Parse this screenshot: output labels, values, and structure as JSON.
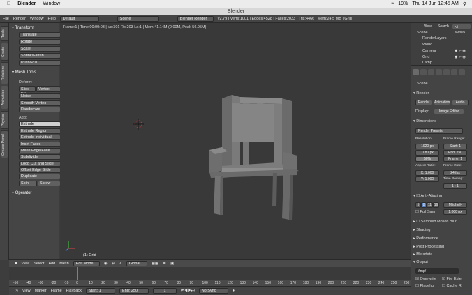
{
  "menubar": {
    "app": "Blender",
    "window": "Window",
    "date_time": "Thu 14 Jun 12:45 AM",
    "battery": "19%"
  },
  "window_title": "Blender",
  "infobar": {
    "menus": [
      "File",
      "Render",
      "Window",
      "Help"
    ],
    "layout": "Default",
    "scene": "Scene",
    "engine": "Blender Render",
    "stats": "v2.79 | Verts:1001 | Edges:4528 | Faces:2033 | Tris:4466 | Mem:24.5 MB | Grid"
  },
  "left_tabs": [
    "Tools",
    "Create",
    "Relations",
    "Animation",
    "Physics",
    "Grease Pencil"
  ],
  "toolshelf": {
    "transform_header": "Transform",
    "transform_buttons": [
      "Translate",
      "Rotate",
      "Scale",
      "Shrink/Fatten",
      "Push/Pull"
    ],
    "mesh_tools_header": "Mesh Tools",
    "deform_label": "Deform:",
    "deform_buttons": [
      "Slide Ed",
      "Vertex",
      "Noise",
      "Smooth Vertex",
      "Randomize"
    ],
    "add_label": "Add:",
    "add_buttons": [
      "Extrude",
      "Extrude Region",
      "Extrude Individual",
      "Inset Faces",
      "Make Edge/Face",
      "Subdivide",
      "Loop Cut and Slide",
      "Offset Edge Slide",
      "Duplicate",
      "Spin",
      "Screw"
    ],
    "operator_header": "Operator"
  },
  "viewport": {
    "info": "Frame:1 | Time:00:00:03 | Ve:301 Ro:203 La:1 | Mem:41.14M (0.00M, Peak 56.95M)",
    "object_label": "(1) Grid"
  },
  "outliner": {
    "buttons": [
      "View",
      "Search",
      "All Scenes"
    ],
    "items": [
      "Scene",
      "RenderLayers",
      "World",
      "Camera",
      "Grid",
      "Lamp"
    ]
  },
  "properties": {
    "scene_label": "Scene",
    "render_header": "Render",
    "render_buttons": [
      "Render",
      "Animation",
      "Audio"
    ],
    "display_label": "Display:",
    "display_value": "Image Editor",
    "dimensions_header": "Dimensions",
    "render_presets": "Render Presets",
    "resolution_label": "Resolution:",
    "res_x": "1920 px",
    "res_y": "1080 px",
    "res_pct": "50%",
    "frame_range_label": "Frame Range:",
    "start": "Start: 1",
    "end": "End: 250",
    "step": "Frame: 1",
    "aspect_label": "Aspect Ratio:",
    "aspect_x": "X: 1.000",
    "aspect_y": "Y: 1.000",
    "frame_rate_label": "Frame Rate:",
    "fps": "24 fps",
    "time_remap_label": "Time Remap:",
    "remap": "1 : 1",
    "aa_header": "Anti-Aliasing",
    "aa_samples": [
      "5",
      "8",
      "11",
      "16"
    ],
    "aa_filter": "Mitchell-",
    "full_sample": "Full Sam",
    "filter_size": "1.000 px",
    "collapsed_sections": [
      "Sampled Motion Blur",
      "Shading",
      "Performance",
      "Post Processing",
      "Metadata"
    ],
    "output_header": "Output",
    "output_path": "/tmp/",
    "overwrite": "Overwrite",
    "file_ext": "File Exte",
    "placeholders": "Placeho",
    "cache_result": "Cache R"
  },
  "view3d_header": {
    "menus": [
      "View",
      "Select",
      "Add",
      "Mesh"
    ],
    "mode": "Edit Mode",
    "orientation": "Global"
  },
  "timeline": {
    "ticks": [
      "-50",
      "-40",
      "-30",
      "-20",
      "-10",
      "0",
      "10",
      "20",
      "30",
      "40",
      "50",
      "60",
      "70",
      "80",
      "90",
      "100",
      "110",
      "120",
      "130",
      "140",
      "150",
      "160",
      "170",
      "180",
      "190",
      "200",
      "210",
      "220",
      "230",
      "240",
      "250",
      "260"
    ],
    "menus": [
      "View",
      "Marker",
      "Frame",
      "Playback"
    ],
    "start": "Start:",
    "start_val": "1",
    "end": "End:",
    "end_val": "250",
    "current": "1",
    "sync": "No Sync"
  }
}
